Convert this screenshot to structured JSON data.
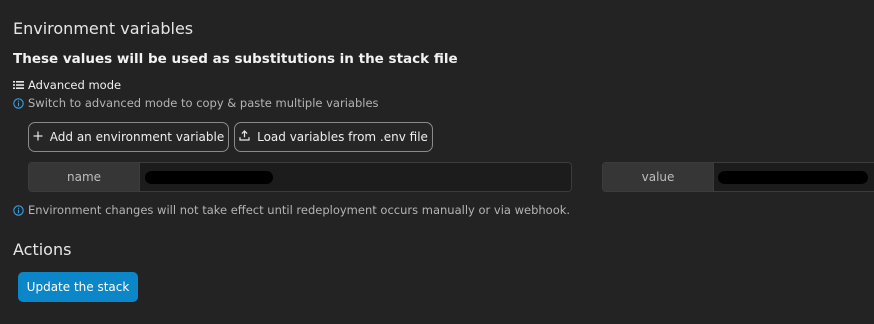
{
  "environment": {
    "title": "Environment variables",
    "subtitle": "These values will be used as substitutions in the stack file",
    "advanced_mode": {
      "label": "Advanced mode",
      "icon": "list-icon",
      "hint": "Switch to advanced mode to copy & paste multiple variables"
    },
    "buttons": {
      "add_variable": "Add an environment variable",
      "load_env_file": "Load variables from .env file"
    },
    "variable": {
      "name_label": "name",
      "value_label": "value"
    },
    "hint": "Environment changes will not take effect until redeployment occurs manually or via webhook."
  },
  "actions": {
    "title": "Actions",
    "update_button": "Update the stack"
  },
  "colors": {
    "background": "#232323",
    "primary": "#0b86c9",
    "info": "#3b9ede"
  }
}
